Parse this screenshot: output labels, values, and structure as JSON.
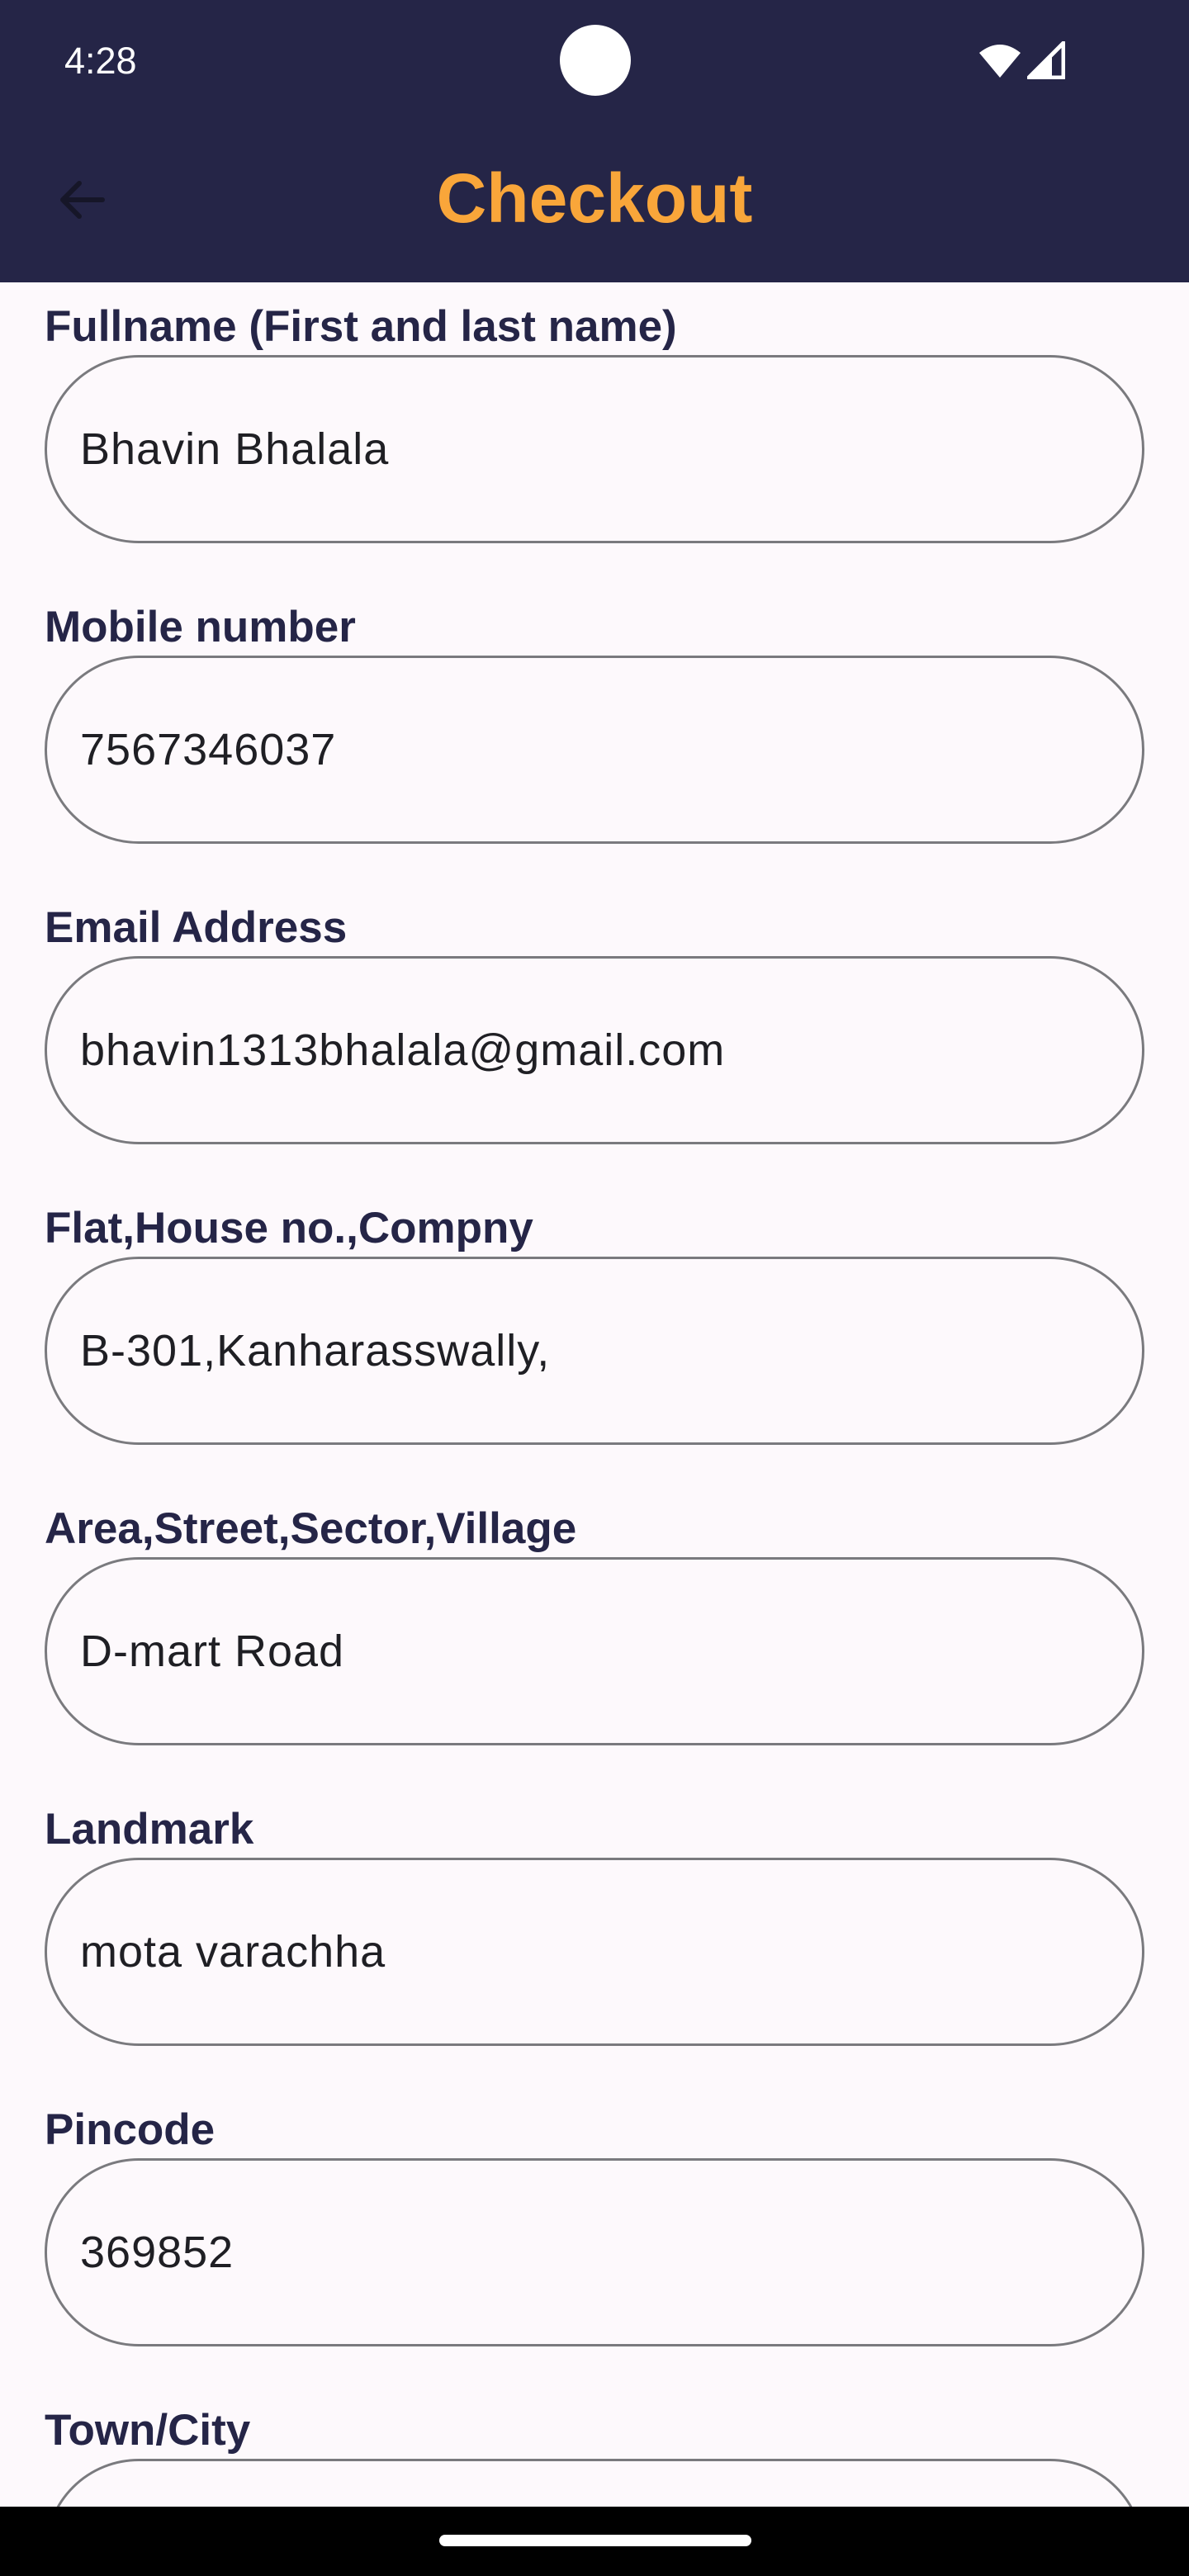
{
  "status_bar": {
    "time": "4:28",
    "icons": [
      "wifi-icon",
      "cellular-signal-icon"
    ]
  },
  "header": {
    "title": "Checkout",
    "back_icon": "arrow-back-icon",
    "background_color": "#252547",
    "title_color": "#f9a63a"
  },
  "form": {
    "fields": [
      {
        "label": "Fullname (First and last name)",
        "value": "Bhavin Bhalala"
      },
      {
        "label": "Mobile number",
        "value": "7567346037"
      },
      {
        "label": "Email Address",
        "value": "bhavin1313bhalala@gmail.com"
      },
      {
        "label": "Flat,House no.,Compny",
        "value": "B-301,Kanharasswally,"
      },
      {
        "label": "Area,Street,Sector,Village",
        "value": "D-mart Road"
      },
      {
        "label": "Landmark",
        "value": "mota varachha"
      },
      {
        "label": "Pincode",
        "value": "369852"
      },
      {
        "label": "Town/City",
        "value": ""
      }
    ]
  },
  "colors": {
    "label_text": "#252547",
    "input_border": "#7a7a7e",
    "page_background": "#fdf9fc"
  }
}
